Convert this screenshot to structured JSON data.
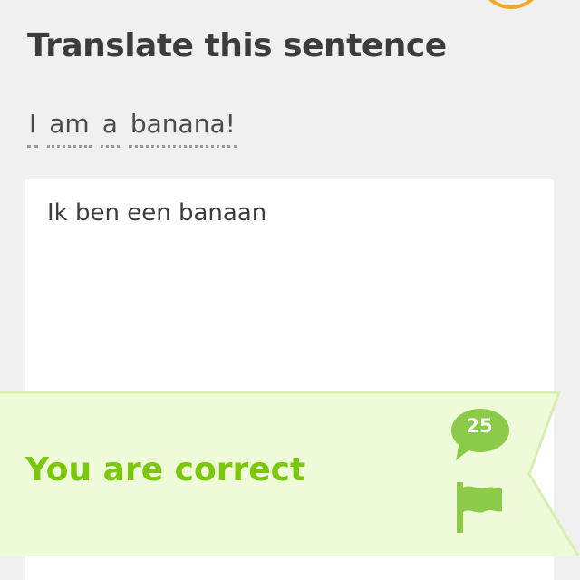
{
  "header": {
    "title": "Translate this sentence"
  },
  "prompt": {
    "words": [
      "I",
      "am",
      "a",
      "banana!"
    ]
  },
  "answer": {
    "value": "Ik ben een banaan"
  },
  "feedback": {
    "message": "You are correct",
    "discussion_count": "25",
    "colors": {
      "banner_bg": "#eefad8",
      "banner_border": "#d6eeb0",
      "accent": "#7ac70c",
      "icon_green": "#8ccb4a"
    }
  },
  "icons": {
    "hearts_ring": "heart-ring-icon",
    "discussion": "speech-bubble-icon",
    "report": "flag-icon"
  }
}
